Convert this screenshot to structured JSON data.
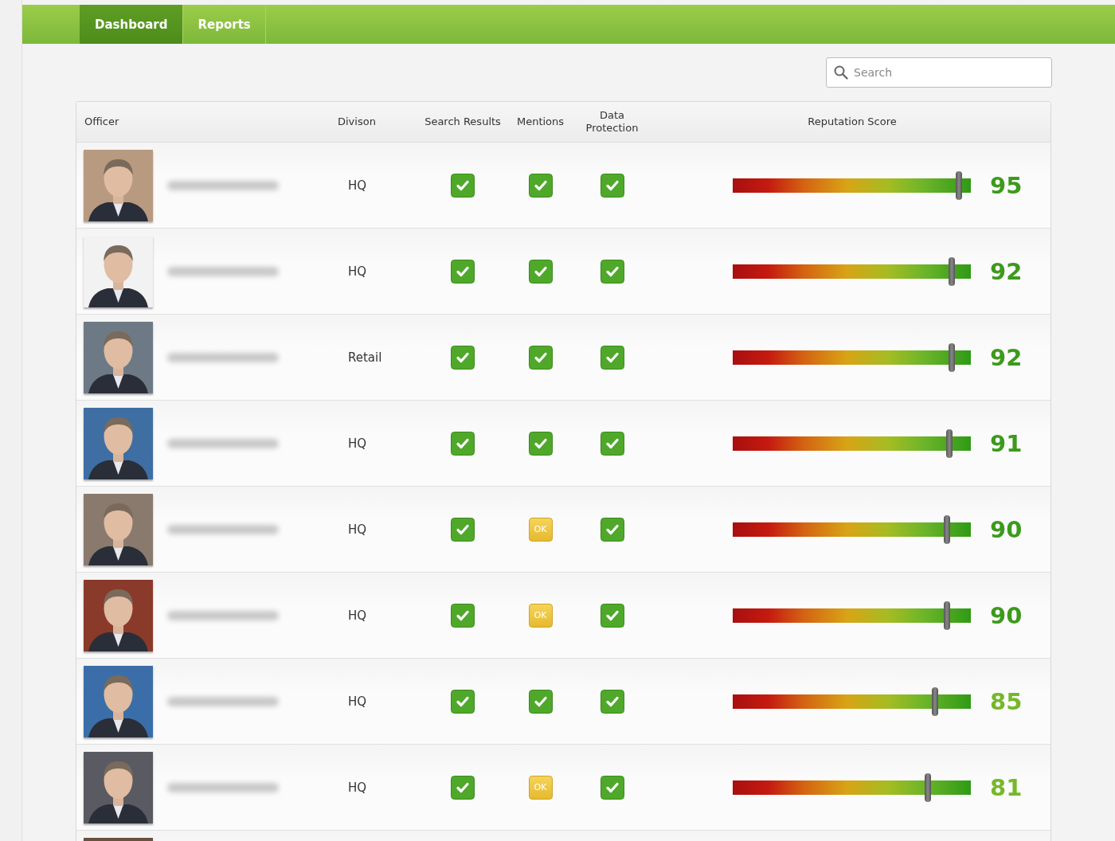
{
  "nav": {
    "tabs": [
      {
        "label": "Dashboard",
        "selected": true
      },
      {
        "label": "Reports",
        "selected": false
      }
    ]
  },
  "search": {
    "placeholder": "Search"
  },
  "table": {
    "columns": [
      "Officer",
      "Divison",
      "Search Results",
      "Mentions",
      "Data Protection",
      "Reputation Score"
    ],
    "rows": [
      {
        "photo": {
          "kind": "picture"
        },
        "division": "HQ",
        "search_results": {
          "kind": "check"
        },
        "mentions": {
          "kind": "check"
        },
        "data_protection": {
          "kind": "check"
        },
        "level": 0.95,
        "score": "95",
        "color": "#3d9a1c"
      },
      {
        "photo": {
          "kind": "picture"
        },
        "division": "HQ",
        "search_results": {
          "kind": "check"
        },
        "mentions": {
          "kind": "check"
        },
        "data_protection": {
          "kind": "check"
        },
        "level": 0.92,
        "score": "92",
        "color": "#3d9a1c"
      },
      {
        "photo": {
          "kind": "picture"
        },
        "division": "Retail",
        "search_results": {
          "kind": "check"
        },
        "mentions": {
          "kind": "check"
        },
        "data_protection": {
          "kind": "check"
        },
        "level": 0.92,
        "score": "92",
        "color": "#3d9a1c"
      },
      {
        "photo": {
          "kind": "picture"
        },
        "division": "HQ",
        "search_results": {
          "kind": "check"
        },
        "mentions": {
          "kind": "check"
        },
        "data_protection": {
          "kind": "check"
        },
        "level": 0.91,
        "score": "91",
        "color": "#3d9a1c"
      },
      {
        "photo": {
          "kind": "picture"
        },
        "division": "HQ",
        "search_results": {
          "kind": "check"
        },
        "mentions": {
          "kind": "ok",
          "label": "OK"
        },
        "data_protection": {
          "kind": "check"
        },
        "level": 0.9,
        "score": "90",
        "color": "#3d9a1c"
      },
      {
        "photo": {
          "kind": "picture"
        },
        "division": "HQ",
        "search_results": {
          "kind": "check"
        },
        "mentions": {
          "kind": "ok",
          "label": "OK"
        },
        "data_protection": {
          "kind": "check"
        },
        "level": 0.9,
        "score": "90",
        "color": "#3d9a1c"
      },
      {
        "photo": {
          "kind": "picture"
        },
        "division": "HQ",
        "search_results": {
          "kind": "check"
        },
        "mentions": {
          "kind": "check"
        },
        "data_protection": {
          "kind": "check"
        },
        "level": 0.85,
        "score": "85",
        "color": "#76b82a"
      },
      {
        "photo": {
          "kind": "picture"
        },
        "division": "HQ",
        "search_results": {
          "kind": "check"
        },
        "mentions": {
          "kind": "ok",
          "label": "OK"
        },
        "data_protection": {
          "kind": "check"
        },
        "level": 0.82,
        "score": "81",
        "color": "#76b82a"
      },
      {
        "photo": {
          "kind": "picture"
        }
      }
    ]
  }
}
